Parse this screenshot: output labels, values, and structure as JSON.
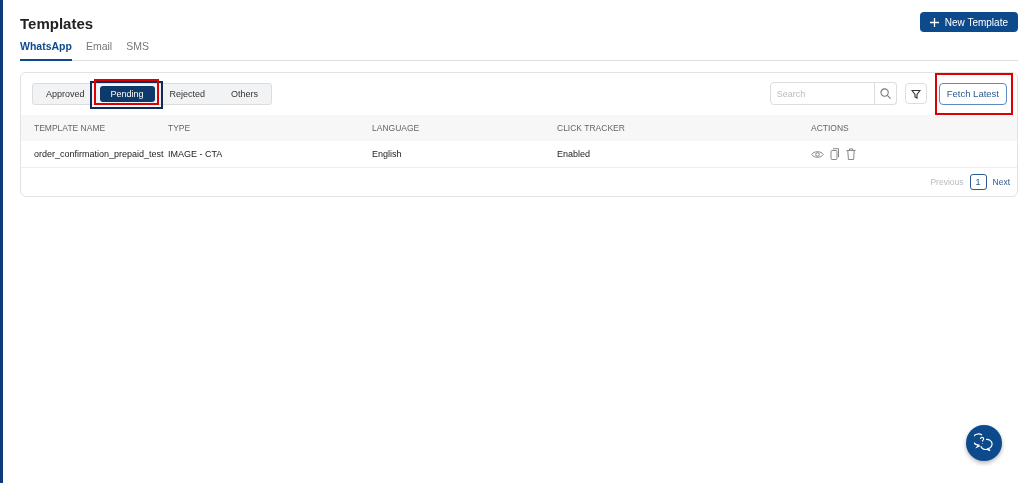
{
  "page": {
    "title": "Templates",
    "new_button": "New Template"
  },
  "tabs": [
    {
      "label": "WhatsApp",
      "selected": true
    },
    {
      "label": "Email",
      "selected": false
    },
    {
      "label": "SMS",
      "selected": false
    }
  ],
  "filters": [
    {
      "label": "Approved",
      "selected": false,
      "highlighted": false
    },
    {
      "label": "Pending",
      "selected": true,
      "highlighted": true
    },
    {
      "label": "Rejected",
      "selected": false,
      "highlighted": false
    },
    {
      "label": "Others",
      "selected": false,
      "highlighted": false
    }
  ],
  "search": {
    "placeholder": "Search"
  },
  "fetch_button": {
    "label": "Fetch Latest",
    "highlighted": true
  },
  "table": {
    "columns": [
      "TEMPLATE NAME",
      "TYPE",
      "LANGUAGE",
      "CLICK TRACKER",
      "ACTIONS"
    ],
    "rows": [
      {
        "name": "order_confirmation_prepaid_test",
        "type": "IMAGE - CTA",
        "language": "English",
        "click_tracker": "Enabled"
      }
    ]
  },
  "pagination": {
    "previous": "Previous",
    "pages": [
      {
        "label": "1",
        "selected": true
      }
    ],
    "next": "Next"
  }
}
